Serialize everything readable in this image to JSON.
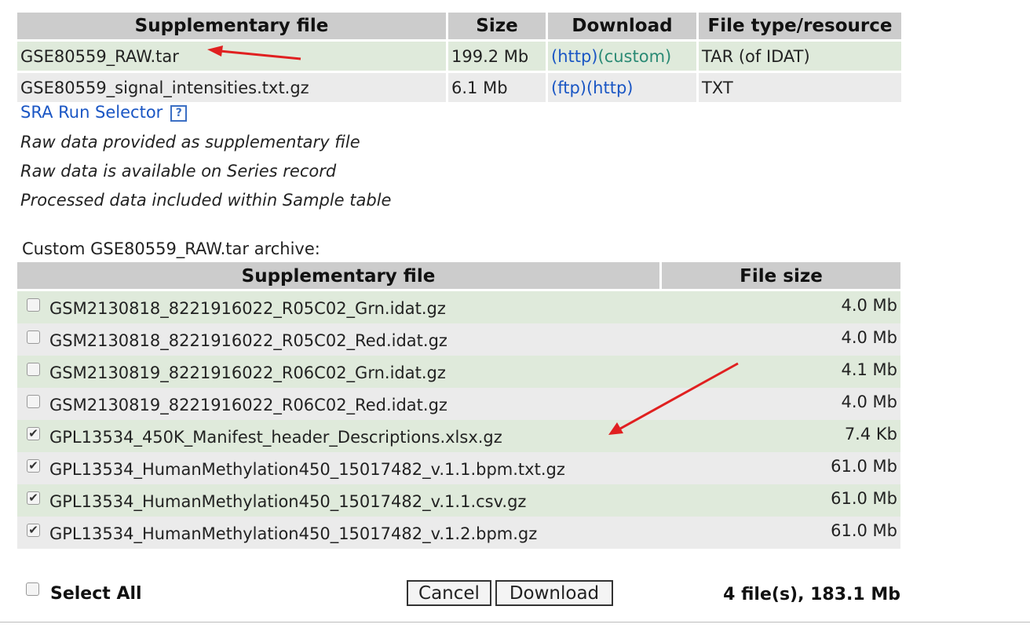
{
  "supp_table": {
    "headers": [
      "Supplementary file",
      "Size",
      "Download",
      "File type/resource"
    ],
    "rows": [
      {
        "file": "GSE80559_RAW.tar",
        "size": "199.2 Mb",
        "links": [
          "(http)",
          "(custom)"
        ],
        "type": "TAR (of IDAT)"
      },
      {
        "file": "GSE80559_signal_intensities.txt.gz",
        "size": "6.1 Mb",
        "links": [
          "(ftp)",
          "(http)"
        ],
        "type": "TXT"
      }
    ]
  },
  "info": {
    "sra_link": "SRA Run Selector",
    "help_glyph": "?",
    "lines": [
      "Raw data provided as supplementary file",
      "Raw data is available on Series record",
      "Processed data included within Sample table"
    ]
  },
  "archive": {
    "label": "Custom GSE80559_RAW.tar archive:",
    "headers": [
      "Supplementary file",
      "File size"
    ],
    "rows": [
      {
        "file": "GSM2130818_8221916022_R05C02_Grn.idat.gz",
        "size": "4.0 Mb",
        "checked": false
      },
      {
        "file": "GSM2130818_8221916022_R05C02_Red.idat.gz",
        "size": "4.0 Mb",
        "checked": false
      },
      {
        "file": "GSM2130819_8221916022_R06C02_Grn.idat.gz",
        "size": "4.1 Mb",
        "checked": false
      },
      {
        "file": "GSM2130819_8221916022_R06C02_Red.idat.gz",
        "size": "4.0 Mb",
        "checked": false
      },
      {
        "file": "GPL13534_450K_Manifest_header_Descriptions.xlsx.gz",
        "size": "7.4 Kb",
        "checked": true
      },
      {
        "file": "GPL13534_HumanMethylation450_15017482_v.1.1.bpm.txt.gz",
        "size": "61.0 Mb",
        "checked": true
      },
      {
        "file": "GPL13534_HumanMethylation450_15017482_v.1.1.csv.gz",
        "size": "61.0 Mb",
        "checked": true
      },
      {
        "file": "GPL13534_HumanMethylation450_15017482_v.1.2.bpm.gz",
        "size": "61.0 Mb",
        "checked": true
      }
    ],
    "select_all": {
      "label": "Select All",
      "checked": false
    },
    "cancel_label": "Cancel",
    "download_label": "Download",
    "summary": "4 file(s), 183.1 Mb"
  },
  "annotation_color": "#e02020"
}
